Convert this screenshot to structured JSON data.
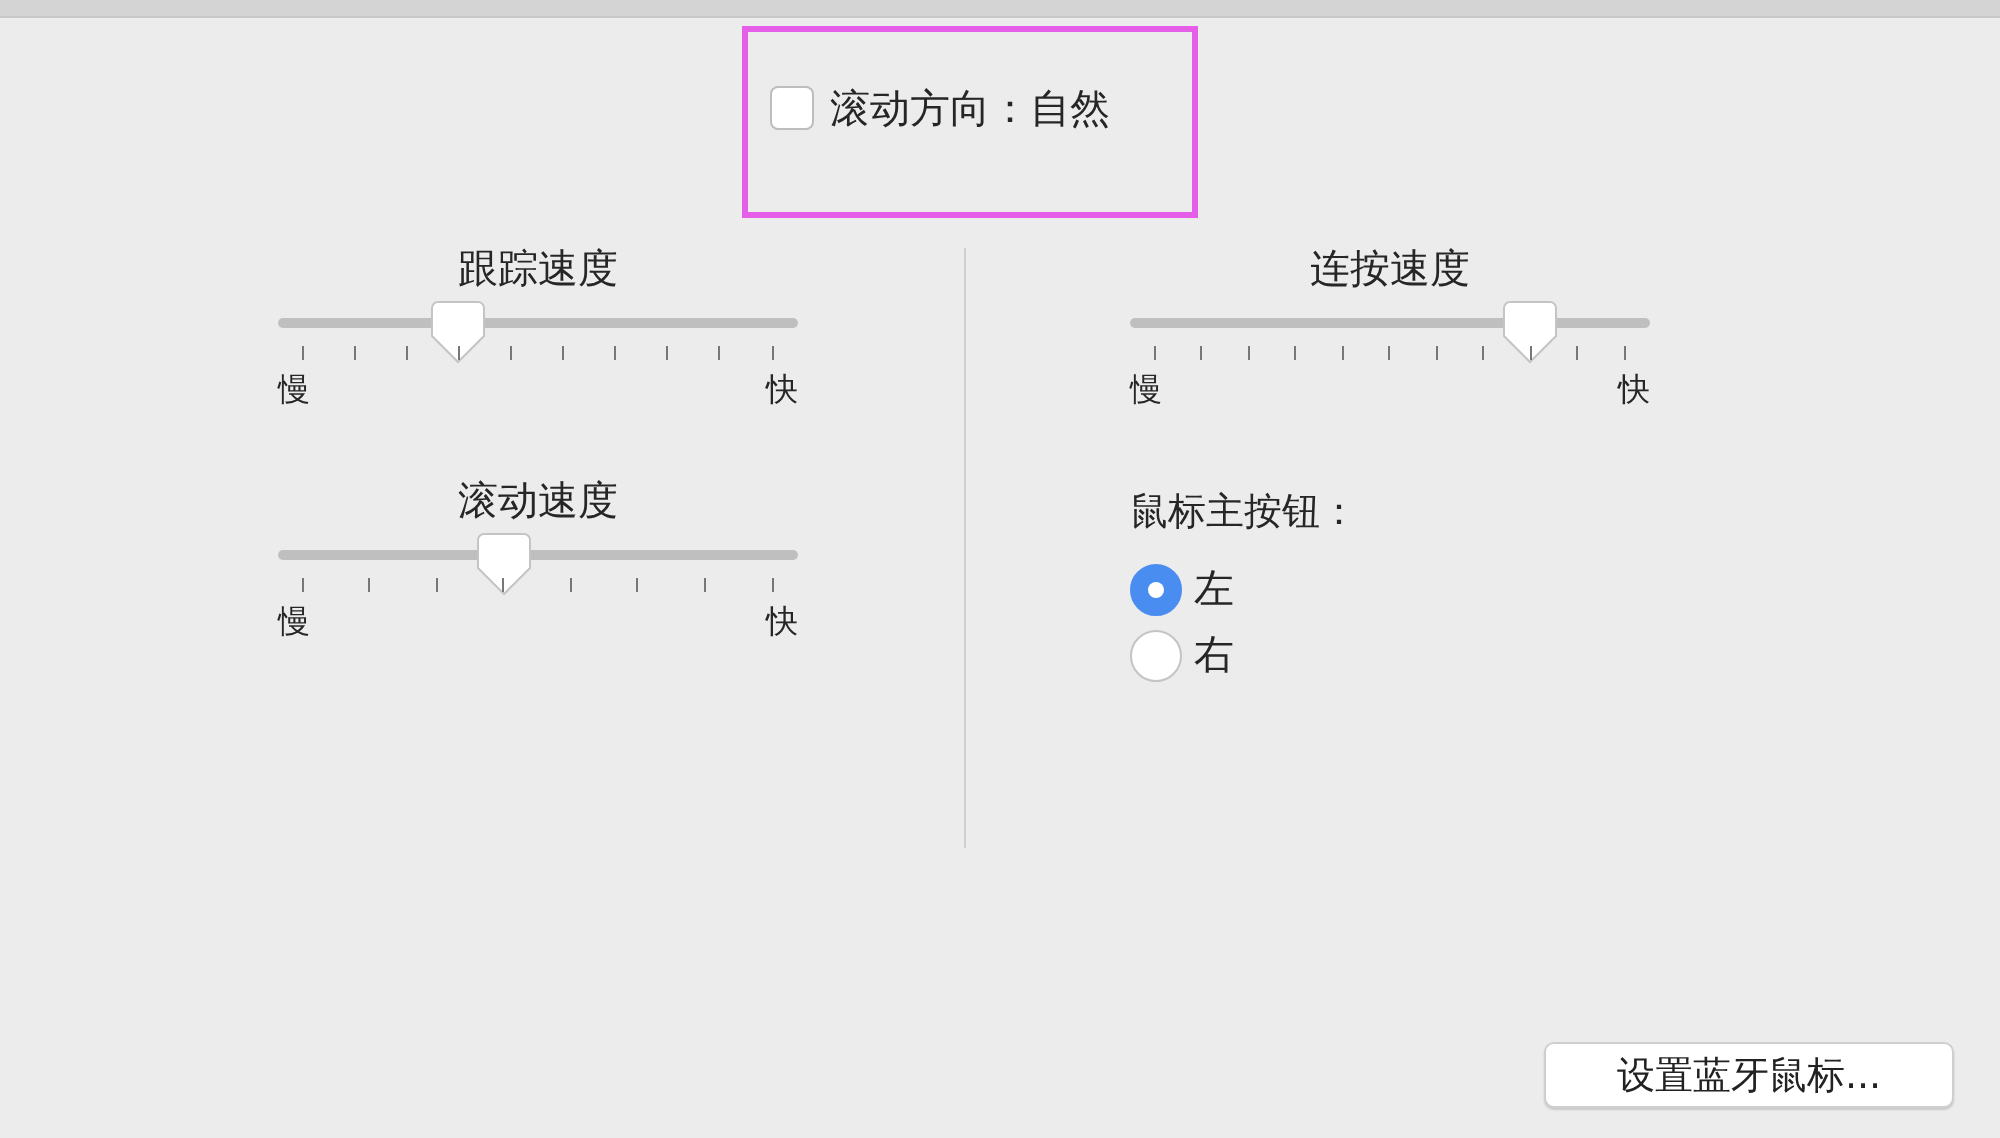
{
  "scroll_direction": {
    "label": "滚动方向：自然",
    "checked": false
  },
  "left_sliders": [
    {
      "title": "跟踪速度",
      "level": 0.3333,
      "min_label": "慢",
      "max_label": "快"
    },
    {
      "title": "滚动速度",
      "level": 0.4286,
      "min_label": "慢",
      "max_label": "快"
    }
  ],
  "right_slider": {
    "title": "连按速度",
    "level": 0.8,
    "min_label": "慢",
    "max_label": "快"
  },
  "primary_button": {
    "label": "鼠标主按钮：",
    "options": [
      {
        "label": "左",
        "selected": true
      },
      {
        "label": "右",
        "selected": false
      }
    ]
  },
  "bluetooth_button": "设置蓝牙鼠标..."
}
